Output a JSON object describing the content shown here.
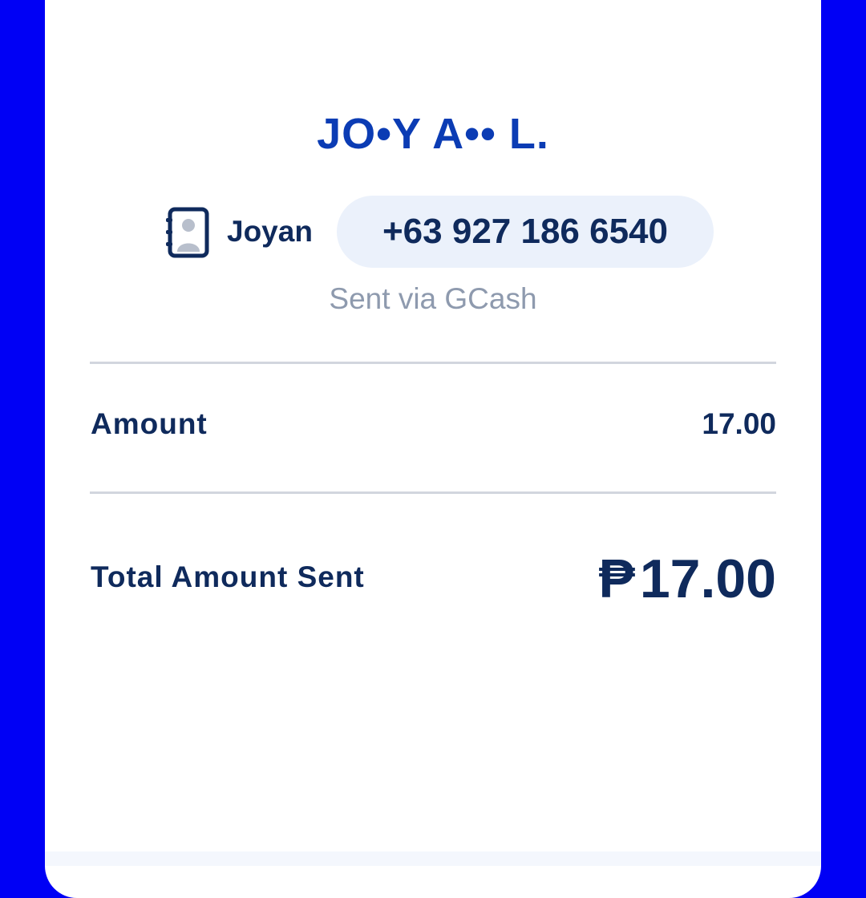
{
  "recipient": {
    "name": "JO•Y A•• L."
  },
  "contact": {
    "icon": "contact-book-icon",
    "name": "Joyan",
    "phone": "+63 927 186 6540"
  },
  "sent_via": "Sent via GCash",
  "amount": {
    "label": "Amount",
    "value": "17.00"
  },
  "total": {
    "label": "Total Amount Sent",
    "currency": "₱",
    "value": "17.00"
  },
  "colors": {
    "background": "#0000f5",
    "accent": "#0062e6",
    "name_blue": "#0b3cb4",
    "text_dark": "#0f2a5c",
    "text_muted": "#8e9aae",
    "pill_bg": "#ebf1fb"
  }
}
